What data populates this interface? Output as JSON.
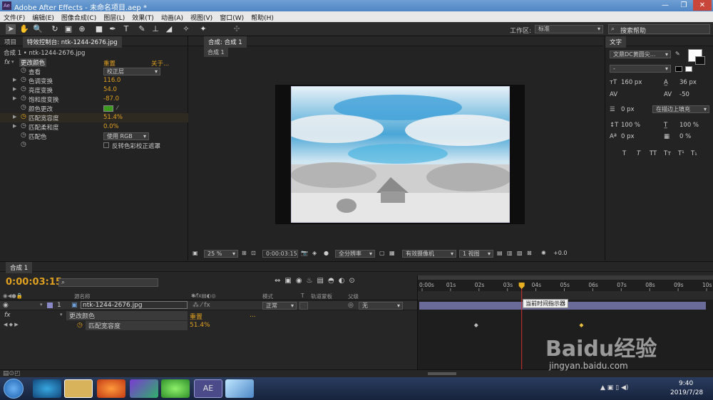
{
  "window": {
    "title": "Adobe After Effects - 未命名项目.aep *",
    "controls": [
      "—",
      "❐",
      "✕"
    ]
  },
  "menu": [
    "文件(F)",
    "编辑(E)",
    "图像合成(C)",
    "图层(L)",
    "效果(T)",
    "动画(A)",
    "视图(V)",
    "窗口(W)",
    "帮助(H)"
  ],
  "toolbar": {
    "workspace_label": "工作区:",
    "workspace_value": "标准",
    "search_placeholder": "搜索帮助"
  },
  "project_panel": {
    "tab_project": "项目",
    "tab_effects": "特效控制台: ntk-1244-2676.jpg",
    "breadcrumb": "合成 1 • ntk-1244-2676.jpg"
  },
  "effect": {
    "fx": "fx",
    "name": "更改颜色",
    "reset": "重置",
    "about": "关于...",
    "params": [
      {
        "label": "查看",
        "value": "校正层",
        "dropdown": true
      },
      {
        "label": "色调变换",
        "value": "116.0",
        "expand": true
      },
      {
        "label": "亮度变换",
        "value": "54.0",
        "expand": true
      },
      {
        "label": "饱和度变换",
        "value": "-87.0",
        "expand": true
      },
      {
        "label": "颜色更改",
        "value": "",
        "swatch": true
      },
      {
        "label": "匹配宽容度",
        "value": "51.4%",
        "expand": true
      },
      {
        "label": "匹配柔和度",
        "value": "0.0%",
        "expand": true
      },
      {
        "label": "匹配色",
        "value": "使用 RGB",
        "dropdown": true
      },
      {
        "label": "",
        "value": "反转色彩校正遮罩",
        "checkbox": true
      }
    ]
  },
  "viewer": {
    "tab_comp": "合成: 合成 1",
    "subtab": "合成 1",
    "zoom": "25 %",
    "timecode": "0:00:03:15",
    "resolution": "全分辨率",
    "camera": "有效摄像机",
    "views": "1 视图",
    "exposure": "+0.0"
  },
  "character_panel": {
    "title": "文字",
    "font": "文鼎DC黄圆尖...",
    "style": "-",
    "size": "160 px",
    "leading": "36 px",
    "tracking": "-50",
    "kerning": "",
    "stroke_width": "0 px",
    "stroke_mode": "在描边上填充",
    "vscale": "100 %",
    "hscale": "100 %",
    "baseline": "0 px",
    "tsume": "0 %",
    "styles": [
      "T",
      "T",
      "TT",
      "Tт",
      "T¹",
      "T₁"
    ]
  },
  "timeline": {
    "tab": "合成 1",
    "timecode": "0:00:03:15",
    "col_headers": {
      "name": "源名称",
      "mode": "模式",
      "t": "T",
      "trkmat": "轨道蒙板",
      "parent": "父级"
    },
    "layer": {
      "num": "1",
      "name": "ntk-1244-2676.jpg",
      "mode": "正常",
      "parent": "无"
    },
    "effect_row": {
      "name": "更改颜色",
      "reset": "重置",
      "dots": "..."
    },
    "param_row": {
      "name": "匹配宽容度",
      "value": "51.4%"
    },
    "ruler": [
      "0:00s",
      "01s",
      "02s",
      "03s",
      "04s",
      "05s",
      "06s",
      "07s",
      "08s",
      "09s",
      "10s"
    ],
    "playhead_sec": 3.5,
    "keyframes_sec": [
      1.9,
      5.6
    ],
    "tooltip": "当前时间指示器"
  },
  "taskbar": {
    "clock_time": "9:40",
    "clock_date": "2019/7/28",
    "active_app": "AE"
  },
  "watermark": {
    "brand": "Baidu经验",
    "url": "jingyan.baidu.com"
  }
}
